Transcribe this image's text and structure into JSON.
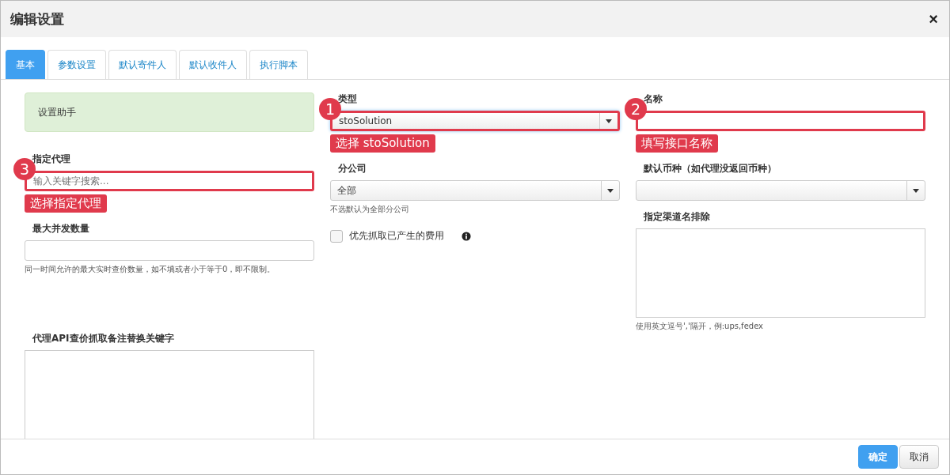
{
  "dialog": {
    "title": "编辑设置",
    "close": "×"
  },
  "tabs": [
    {
      "label": "基本",
      "selected": true
    },
    {
      "label": "参数设置",
      "selected": false
    },
    {
      "label": "默认寄件人",
      "selected": false
    },
    {
      "label": "默认收件人",
      "selected": false
    },
    {
      "label": "执行脚本",
      "selected": false
    }
  ],
  "columns": [
    [
      {
        "kind": "alert",
        "text": "设置助手"
      },
      {
        "kind": "input",
        "label": "指定代理",
        "placeholder": "输入关键字搜索...",
        "annotation": {
          "number": "3",
          "text": "选择指定代理"
        }
      },
      {
        "kind": "input",
        "label": "最大并发数量",
        "help": "同一时间允许的最大实时查价数量，如不填或者小于等于0，即不限制。"
      },
      {
        "kind": "textarea",
        "label": "代理API查价抓取备注替换关键字"
      }
    ],
    [
      {
        "kind": "select",
        "label": "类型",
        "value": "stoSolution",
        "focused": true,
        "annotation": {
          "number": "1",
          "text": "选择 stoSolution"
        }
      },
      {
        "kind": "select",
        "label": "分公司",
        "value": "全部",
        "help": "不选默认为全部分公司"
      },
      {
        "kind": "checkbox",
        "label": "优先抓取已产生的费用",
        "checked": false
      }
    ],
    [
      {
        "kind": "input",
        "label": "名称",
        "annotation": {
          "number": "2",
          "text": "填写接口名称"
        }
      },
      {
        "kind": "select",
        "label": "默认币种（如代理没返回币种）"
      },
      {
        "kind": "textarea",
        "label": "指定渠道名排除",
        "help": "使用英文逗号','隔开，例:ups,fedex"
      }
    ]
  ],
  "buttons": [
    {
      "label": "确定",
      "kind": "primary"
    },
    {
      "label": "取消",
      "kind": "default"
    }
  ]
}
